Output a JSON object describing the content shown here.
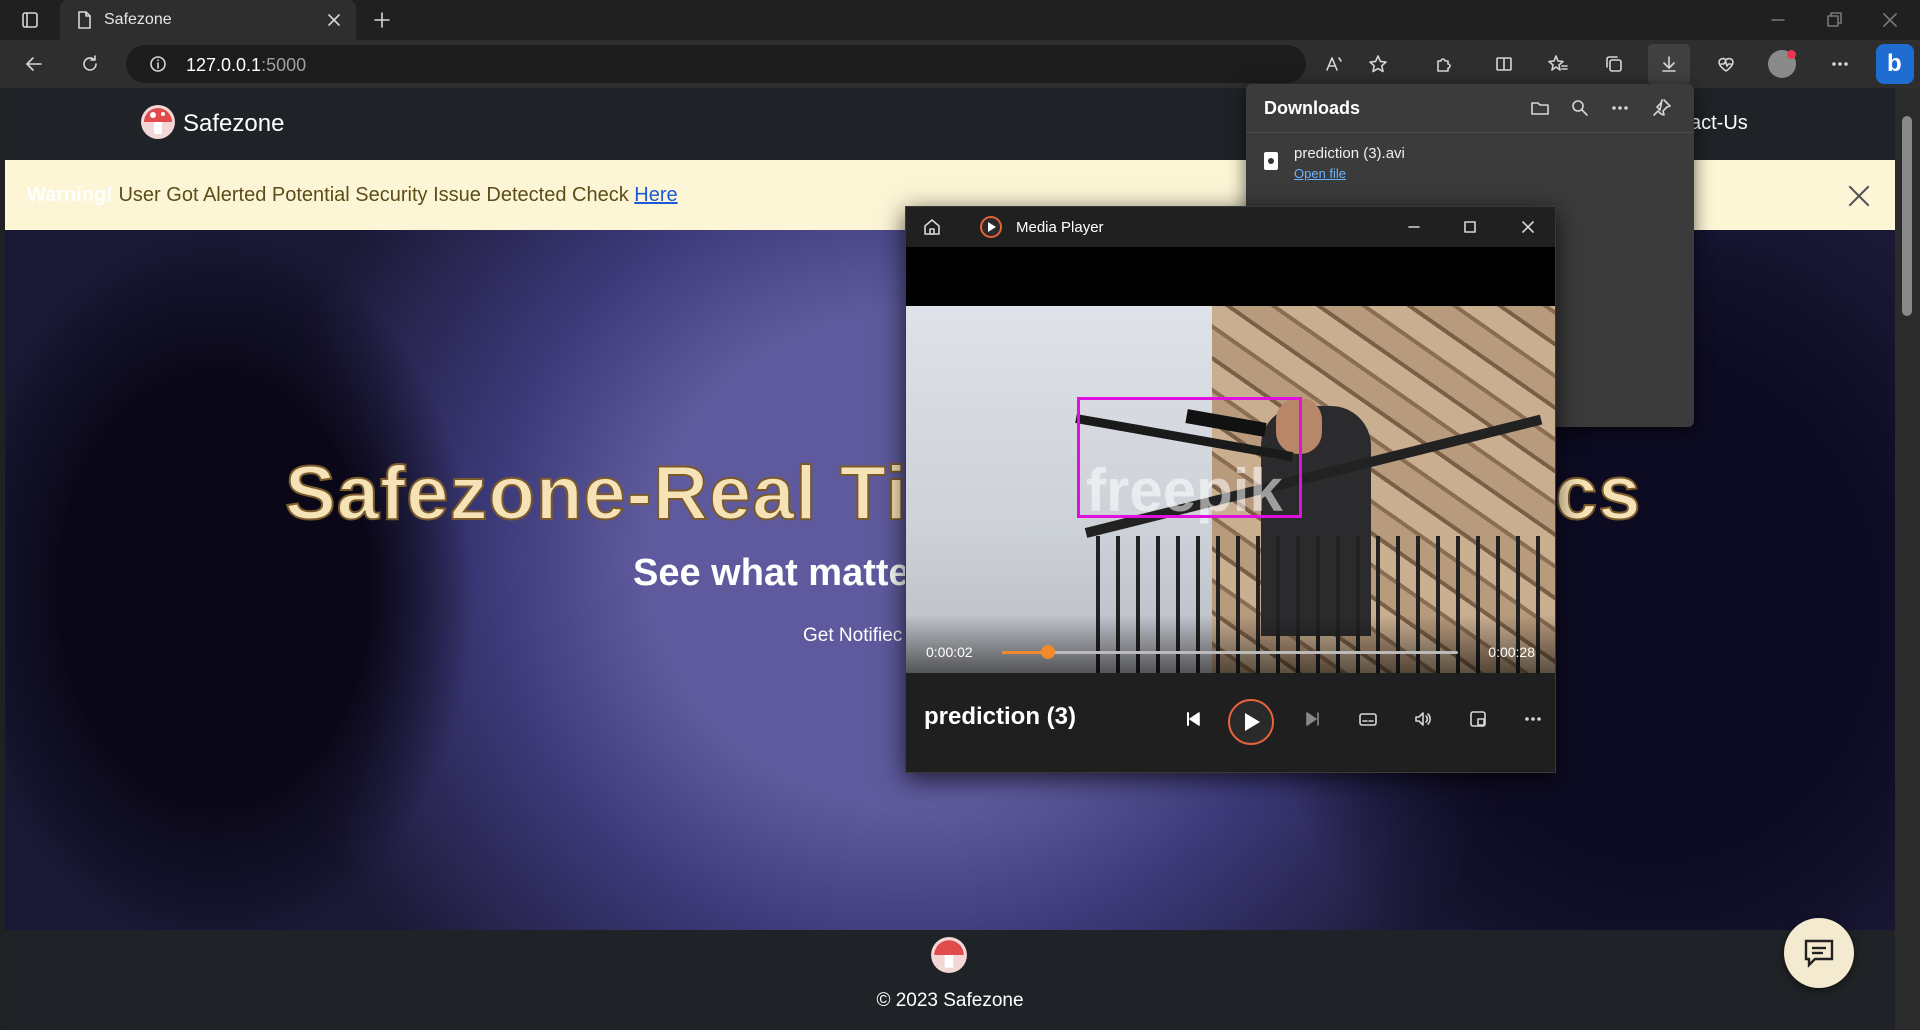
{
  "browser": {
    "tab_title": "Safezone",
    "url_host": "127.0.0.1",
    "url_port": ":5000"
  },
  "site": {
    "brand": "Safezone",
    "nav_contact": "act-Us",
    "alert": {
      "label": "Warning!",
      "message": " User Got Alerted Potential Security Issue Detected Check ",
      "link": "Here"
    },
    "hero": {
      "title_left": "Safezone-Real Ti",
      "title_right": "cs",
      "subtitle": "See what matte",
      "tagline": "Get Notifiec"
    },
    "footer_copyright": "© 2023 Safezone"
  },
  "downloads": {
    "header": "Downloads",
    "file_name": "prediction (3).avi",
    "open_link": "Open file"
  },
  "media_player": {
    "app_title": "Media Player",
    "now_playing": "prediction (3)",
    "current_time": "0:00:02",
    "total_time": "0:00:28",
    "progress": 0.1,
    "watermark": "freepik",
    "accent": "#f08a2c"
  },
  "colors": {
    "alert_bg": "#fdf6d6",
    "detect_box": "#e011e0",
    "link": "#1b5ad6"
  }
}
